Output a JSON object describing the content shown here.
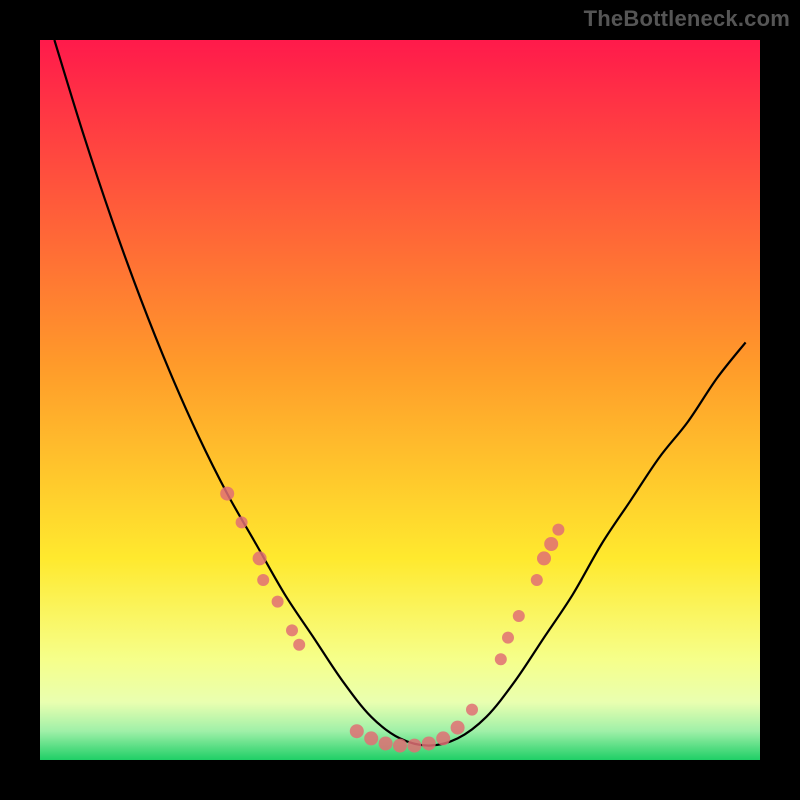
{
  "watermark": "TheBottleneck.com",
  "chart_data": {
    "type": "line",
    "title": "",
    "xlabel": "",
    "ylabel": "",
    "xlim": [
      0,
      100
    ],
    "ylim": [
      0,
      100
    ],
    "grid": false,
    "legend": false,
    "background_gradient": {
      "top_color": "#ff1a4b",
      "mid_color": "#ffe92e",
      "bottom_green_top": "#e9ffb0",
      "bottom_green_low": "#1fcf66"
    },
    "series": [
      {
        "name": "bottleneck-curve",
        "color": "#000000",
        "x": [
          2,
          6,
          10,
          14,
          18,
          22,
          26,
          30,
          34,
          38,
          42,
          46,
          50,
          54,
          58,
          62,
          66,
          70,
          74,
          78,
          82,
          86,
          90,
          94,
          98
        ],
        "y": [
          100,
          87,
          75,
          64,
          54,
          45,
          37,
          30,
          23,
          17,
          11,
          6,
          3,
          2,
          3,
          6,
          11,
          17,
          23,
          30,
          36,
          42,
          47,
          53,
          58
        ]
      }
    ],
    "markers": {
      "name": "highlighted-points",
      "color": "#e06f74",
      "points": [
        {
          "x": 26,
          "y": 37,
          "r": 7
        },
        {
          "x": 28,
          "y": 33,
          "r": 6
        },
        {
          "x": 30.5,
          "y": 28,
          "r": 7
        },
        {
          "x": 31,
          "y": 25,
          "r": 6
        },
        {
          "x": 33,
          "y": 22,
          "r": 6
        },
        {
          "x": 35,
          "y": 18,
          "r": 6
        },
        {
          "x": 36,
          "y": 16,
          "r": 6
        },
        {
          "x": 44,
          "y": 4,
          "r": 7
        },
        {
          "x": 46,
          "y": 3,
          "r": 7
        },
        {
          "x": 48,
          "y": 2.3,
          "r": 7
        },
        {
          "x": 50,
          "y": 2,
          "r": 7
        },
        {
          "x": 52,
          "y": 2,
          "r": 7
        },
        {
          "x": 54,
          "y": 2.3,
          "r": 7
        },
        {
          "x": 56,
          "y": 3,
          "r": 7
        },
        {
          "x": 58,
          "y": 4.5,
          "r": 7
        },
        {
          "x": 60,
          "y": 7,
          "r": 6
        },
        {
          "x": 64,
          "y": 14,
          "r": 6
        },
        {
          "x": 65,
          "y": 17,
          "r": 6
        },
        {
          "x": 66.5,
          "y": 20,
          "r": 6
        },
        {
          "x": 69,
          "y": 25,
          "r": 6
        },
        {
          "x": 70,
          "y": 28,
          "r": 7
        },
        {
          "x": 71,
          "y": 30,
          "r": 7
        },
        {
          "x": 72,
          "y": 32,
          "r": 6
        }
      ]
    }
  }
}
